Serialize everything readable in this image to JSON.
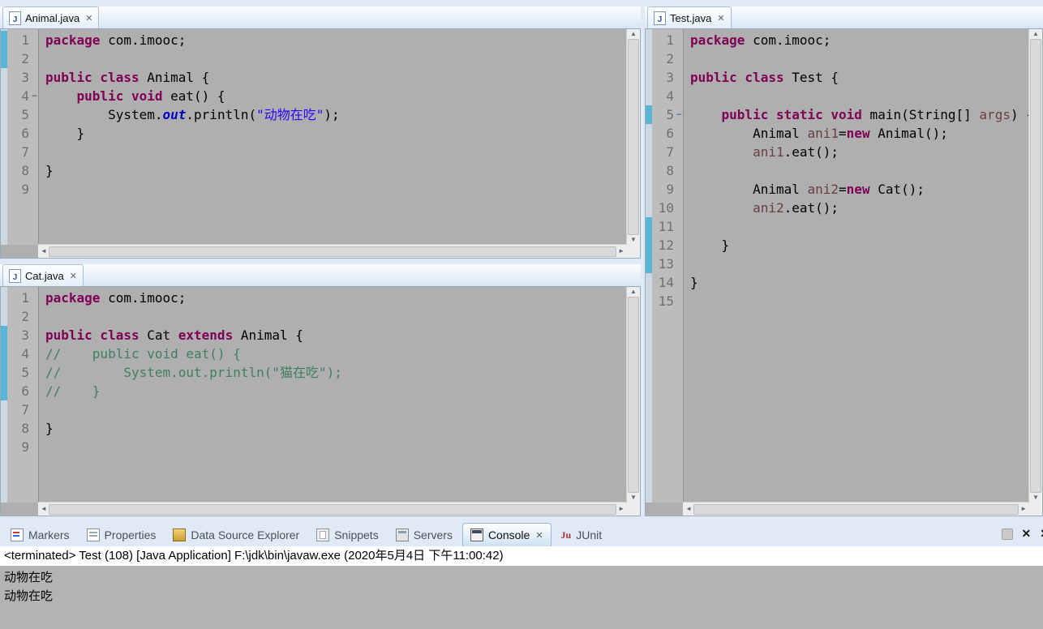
{
  "colors": {
    "keyword": "#7f0055",
    "string": "#2a00ff",
    "comment": "#3f7f5f",
    "static_field": "#0000c0",
    "variable": "#6a3e3e",
    "editor_bg": "#afafaf",
    "change_bar": "#58b5d6"
  },
  "editors": [
    {
      "tab": "Animal.java",
      "changed_lines": [
        1,
        2
      ],
      "fold_lines": [
        4
      ],
      "lines": [
        [
          [
            "kw",
            "package"
          ],
          [
            "p",
            " com.imooc;"
          ]
        ],
        [],
        [
          [
            "kw",
            "public class"
          ],
          [
            "p",
            " Animal {"
          ]
        ],
        [
          [
            "p",
            "    "
          ],
          [
            "kw",
            "public void"
          ],
          [
            "p",
            " eat() {"
          ]
        ],
        [
          [
            "p",
            "        System."
          ],
          [
            "sf",
            "out"
          ],
          [
            "p",
            ".println("
          ],
          [
            "s",
            "\"动物在吃\""
          ],
          [
            "p",
            ");"
          ]
        ],
        [
          [
            "p",
            "    }"
          ]
        ],
        [],
        [
          [
            "p",
            "}"
          ]
        ],
        []
      ]
    },
    {
      "tab": "Cat.java",
      "changed_lines": [
        3,
        4,
        5,
        6
      ],
      "fold_lines": [],
      "lines": [
        [
          [
            "kw",
            "package"
          ],
          [
            "p",
            " com.imooc;"
          ]
        ],
        [],
        [
          [
            "kw",
            "public class"
          ],
          [
            "p",
            " Cat "
          ],
          [
            "kw",
            "extends"
          ],
          [
            "p",
            " Animal {"
          ]
        ],
        [
          [
            "c",
            "//    public void eat() {"
          ]
        ],
        [
          [
            "c",
            "//        System.out.println(\"猫在吃\");"
          ]
        ],
        [
          [
            "c",
            "//    }"
          ]
        ],
        [],
        [
          [
            "p",
            "}"
          ]
        ],
        []
      ]
    },
    {
      "tab": "Test.java",
      "changed_lines": [
        5,
        11,
        12,
        13
      ],
      "fold_lines": [
        5
      ],
      "lines": [
        [
          [
            "kw",
            "package"
          ],
          [
            "p",
            " com.imooc;"
          ]
        ],
        [],
        [
          [
            "kw",
            "public class"
          ],
          [
            "p",
            " Test {"
          ]
        ],
        [],
        [
          [
            "p",
            "    "
          ],
          [
            "kw",
            "public static void"
          ],
          [
            "p",
            " main(String[] "
          ],
          [
            "v",
            "args"
          ],
          [
            "p",
            ") {"
          ]
        ],
        [
          [
            "p",
            "        Animal "
          ],
          [
            "v",
            "ani1"
          ],
          [
            "p",
            "="
          ],
          [
            "kw",
            "new"
          ],
          [
            "p",
            " Animal();"
          ]
        ],
        [
          [
            "p",
            "        "
          ],
          [
            "v",
            "ani1"
          ],
          [
            "p",
            ".eat();"
          ]
        ],
        [],
        [
          [
            "p",
            "        Animal "
          ],
          [
            "v",
            "ani2"
          ],
          [
            "p",
            "="
          ],
          [
            "kw",
            "new"
          ],
          [
            "p",
            " Cat();"
          ]
        ],
        [
          [
            "p",
            "        "
          ],
          [
            "v",
            "ani2"
          ],
          [
            "p",
            ".eat();"
          ]
        ],
        [],
        [
          [
            "p",
            "    }"
          ]
        ],
        [],
        [
          [
            "p",
            "}"
          ]
        ],
        []
      ]
    }
  ],
  "bottom": {
    "tabs": [
      {
        "label": "Markers",
        "icon": "markers-icon"
      },
      {
        "label": "Properties",
        "icon": "properties-icon"
      },
      {
        "label": "Data Source Explorer",
        "icon": "data-source-explorer-icon"
      },
      {
        "label": "Snippets",
        "icon": "snippets-icon"
      },
      {
        "label": "Servers",
        "icon": "servers-icon"
      },
      {
        "label": "Console",
        "icon": "console-icon",
        "selected": true,
        "closable": true
      },
      {
        "label": "JUnit",
        "icon": "junit-icon",
        "glyph": "Ju"
      }
    ],
    "status": "<terminated> Test (108) [Java Application] F:\\jdk\\bin\\javaw.exe (2020年5月4日 下午11:00:42)",
    "output": [
      "动物在吃",
      "动物在吃"
    ]
  }
}
